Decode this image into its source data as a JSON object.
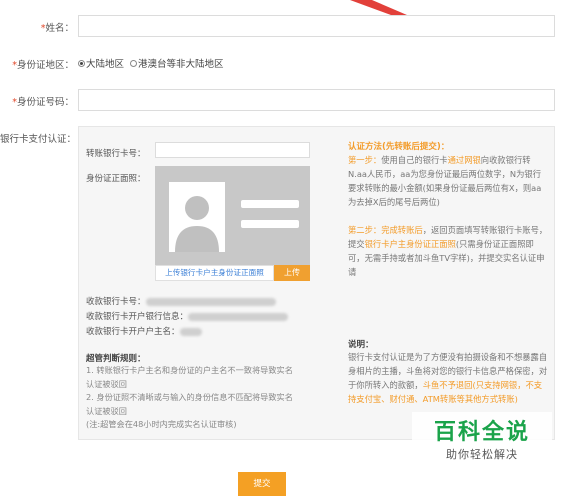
{
  "form": {
    "name": {
      "req": "*",
      "label": "姓名：",
      "value": ""
    },
    "region": {
      "req": "*",
      "label": "身份证地区：",
      "options": [
        {
          "label": "大陆地区",
          "checked": true
        },
        {
          "label": "港澳台等非大陆地区",
          "checked": false
        }
      ]
    },
    "id_number": {
      "req": "*",
      "label": "身份证号码：",
      "value": ""
    },
    "bank_auth": {
      "label": "银行卡支付认证："
    }
  },
  "panel": {
    "transfer_card_label": "转账银行卡号：",
    "id_front_label": "身份证正面照：",
    "upload_text": "上传银行卡户主身份证正面照",
    "upload_button": "上传",
    "receive_card_label": "收款银行卡号：",
    "receive_bank_label": "收款银行卡开户银行信息：",
    "receive_owner_label": "收款银行卡开户户主名：",
    "rules_title": "超管判断规则：",
    "rules": [
      "1. 转账银行卡户主名和身份证的户主名不一致将导致实名",
      "认证被驳回",
      "2. 身份证照不清晰或与输入的身份信息不匹配将导致实名",
      "认证被驳回",
      "(注:超管会在48小时内完成实名认证审核)"
    ],
    "method_title": "认证方法(先转账后提交)：",
    "step1": {
      "prefix": "第一步：",
      "t1": "使用自己的银行卡",
      "h1": "通过网银",
      "t2": "向收款银行转N.aa人民币，aa为您身份证最后两位数字，N为银行要求转账的最小金额(如果身份证最后两位有X，则aa为去掉X后的尾号后两位)"
    },
    "step2": {
      "prefix": "第二步：",
      "h1": "完成转账后",
      "t1": "，返回页面填写转账银行卡账号，提交",
      "h2": "银行卡户主身份证正面照",
      "t2": "(只需身份证正面照即可，无需手持或者加斗鱼TV字样)，并提交实名认证申请"
    },
    "note_title": "说明：",
    "note": {
      "t1": "银行卡支付认证是为了方便没有拍摄设备和不想暴露自身相片的主播，斗鱼将对您的银行卡信息严格保密，对于你所转入的款额，",
      "h1": "斗鱼不予退回(只支持网银，不支持支付宝、财付通、ATM转账等其他方式转账)"
    }
  },
  "submit_label": "提交",
  "watermark": {
    "title": "百科全说",
    "subtitle": "助你轻松解决"
  },
  "colors": {
    "accent": "#f39c2a",
    "required": "#e2492b",
    "link": "#3b7fd6"
  }
}
